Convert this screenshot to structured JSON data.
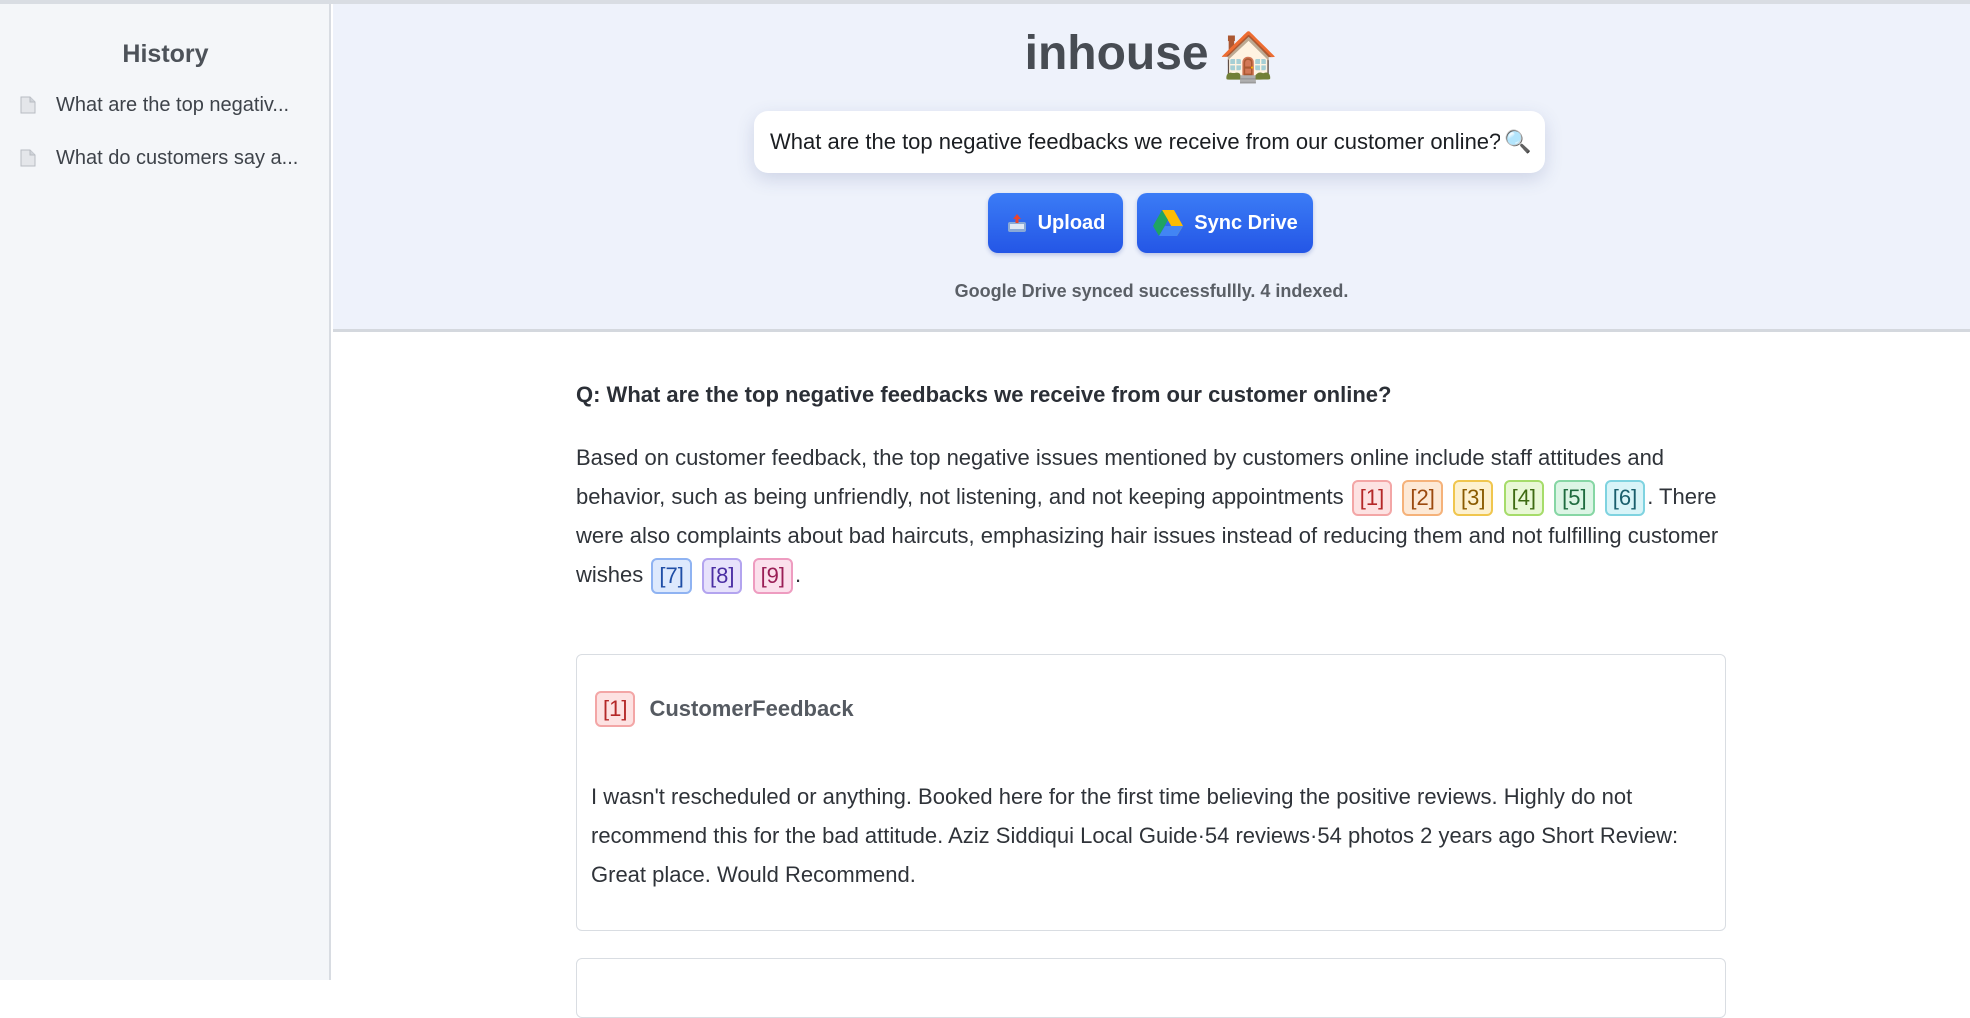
{
  "sidebar": {
    "title": "History",
    "items": [
      {
        "label": "What are the top negativ..."
      },
      {
        "label": "What do customers say a..."
      }
    ]
  },
  "header": {
    "brand": "inhouse",
    "brand_emoji": "🏠",
    "search": {
      "value": "What are the top negative feedbacks we receive from our customer online?",
      "icon": "🔍"
    },
    "buttons": {
      "upload": "Upload",
      "sync": "Sync Drive"
    },
    "status": "Google Drive synced successfullly. 4 indexed."
  },
  "main": {
    "question": "Q: What are the top negative feedbacks we receive from our customer online?",
    "answer": {
      "part1": "Based on customer feedback, the top negative issues mentioned by customers online include staff attitudes and behavior, such as being unfriendly, not listening, and not keeping appointments",
      "part2": ". There were also complaints about bad haircuts, emphasizing hair issues instead of reducing them and not fulfilling customer wishes",
      "part3": "."
    },
    "citations": [
      "[1]",
      "[2]",
      "[3]",
      "[4]",
      "[5]",
      "[6]",
      "[7]",
      "[8]",
      "[9]"
    ],
    "source_card": {
      "citation": "[1]",
      "title": "CustomerFeedback",
      "body": "I wasn't rescheduled or anything. Booked here for the first time believing the positive reviews. Highly do not recommend this for the bad attitude. Aziz Siddiqui Local Guide·54 reviews·54 photos 2 years ago Short Review: Great place. Would Recommend."
    }
  }
}
